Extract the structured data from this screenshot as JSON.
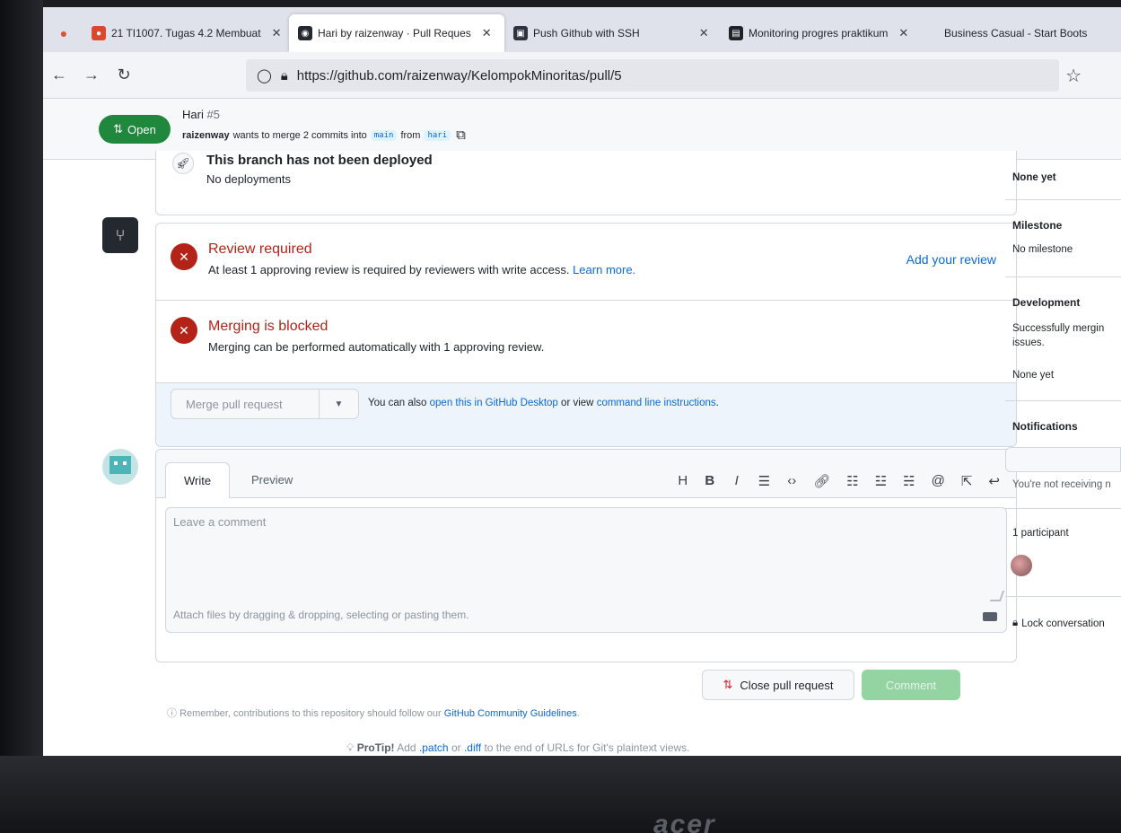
{
  "browser": {
    "tabs": [
      {
        "label": "21 TI1007. Tugas 4.2 Membuat",
        "active": false
      },
      {
        "label": "Hari by raizenway · Pull Reques",
        "active": true
      },
      {
        "label": "Push Github with SSH",
        "active": false
      },
      {
        "label": "Monitoring progres praktikum",
        "active": false
      },
      {
        "label": "Business Casual - Start Boots",
        "active": false
      }
    ],
    "url": "https://github.com/raizenway/KelompokMinoritas/pull/5"
  },
  "pr": {
    "state": "Open",
    "title": "Hari",
    "number": "#5",
    "author": "raizenway",
    "merge_text": "wants to merge 2 commits into",
    "base": "main",
    "from_text": "from",
    "head": "hari"
  },
  "deployment": {
    "title": "This branch has not been deployed",
    "sub": "No deployments"
  },
  "merge": {
    "review_title": "Review required",
    "review_desc": "At least 1 approving review is required by reviewers with write access.",
    "learn_more": "Learn more.",
    "add_review": "Add your review",
    "blocked_title": "Merging is blocked",
    "blocked_desc": "Merging can be performed automatically with 1 approving review.",
    "merge_button": "Merge pull request",
    "alt_prefix": "You can also",
    "alt_link1": "open this in GitHub Desktop",
    "alt_mid": "or view",
    "alt_link2": "command line instructions",
    "alt_suffix": "."
  },
  "composer": {
    "tab_write": "Write",
    "tab_preview": "Preview",
    "toolbar": [
      "H",
      "B",
      "I"
    ],
    "placeholder": "Leave a comment",
    "attach_hint": "Attach files by dragging & dropping, selecting or pasting them.",
    "close_button": "Close pull request",
    "comment_button": "Comment",
    "remember_prefix": "Remember, contributions to this repository should follow our",
    "remember_link": "GitHub Community Guidelines",
    "remember_suffix": ".",
    "protip_label": "ProTip!",
    "protip_text_1": "Add",
    "protip_patch": ".patch",
    "protip_or": "or",
    "protip_diff": ".diff",
    "protip_text_2": "to the end of URLs for Git's plaintext views."
  },
  "sidebar": {
    "none_yet_top": "None yet",
    "milestone_label": "Milestone",
    "milestone_value": "No milestone",
    "development_label": "Development",
    "development_text": "Successfully mergin issues.",
    "development_value": "None yet",
    "notifications_label": "Notifications",
    "notifications_text": "You're not receiving n",
    "participants_label": "1 participant",
    "lock_label": "Lock conversation"
  },
  "device": {
    "brand": "acer"
  }
}
